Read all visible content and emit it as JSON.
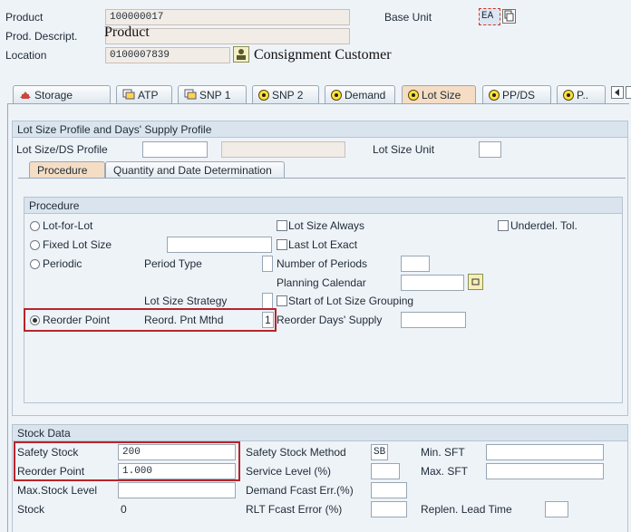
{
  "header": {
    "product_label": "Product",
    "product_value": "100000017",
    "prod_descript_label": "Prod. Descript.",
    "prod_descript_value": "Product",
    "location_label": "Location",
    "location_value": "0100007839",
    "location_name": "Consignment Customer",
    "base_unit_label": "Base Unit",
    "base_unit_value": "EA"
  },
  "tabs": [
    {
      "label": "Storage",
      "icon": "storage-icon"
    },
    {
      "label": "ATP",
      "icon": "atp-icon"
    },
    {
      "label": "SNP 1",
      "icon": "snp-icon"
    },
    {
      "label": "SNP 2",
      "icon": "radio-icon"
    },
    {
      "label": "Demand",
      "icon": "radio-icon"
    },
    {
      "label": "Lot Size",
      "icon": "radio-icon",
      "active": true
    },
    {
      "label": "PP/DS",
      "icon": "radio-icon"
    },
    {
      "label": "P..",
      "icon": "radio-icon"
    }
  ],
  "lot_size_profile": {
    "section_title": "Lot Size Profile and Days' Supply Profile",
    "profile_label": "Lot Size/DS Profile",
    "profile_value": "",
    "profile_desc": "",
    "unit_label": "Lot Size Unit",
    "unit_value": ""
  },
  "subtabs": {
    "procedure": "Procedure",
    "quantity": "Quantity and Date Determination"
  },
  "procedure": {
    "title": "Procedure",
    "lot_for_lot": "Lot-for-Lot",
    "fixed_lot_size": "Fixed Lot Size",
    "periodic": "Periodic",
    "reorder_point": "Reorder Point",
    "period_type": "Period Type",
    "lot_size_strategy": "Lot Size Strategy",
    "reord_pnt_mthd": "Reord. Pnt Mthd",
    "reord_pnt_mthd_value": "1",
    "lot_size_always": "Lot Size Always",
    "last_lot_exact": "Last Lot Exact",
    "number_of_periods": "Number of Periods",
    "planning_calendar": "Planning Calendar",
    "start_of_lot_size_grouping": "Start of Lot Size Grouping",
    "reorder_days_supply": "Reorder Days' Supply",
    "underdel_tol": "Underdel. Tol.",
    "selected": "reorder_point"
  },
  "stock": {
    "title": "Stock Data",
    "safety_stock_label": "Safety Stock",
    "safety_stock_value": "200",
    "reorder_point_label": "Reorder Point",
    "reorder_point_value": "1.000",
    "max_stock_label": "Max.Stock Level",
    "max_stock_value": "",
    "stock_label": "Stock",
    "stock_value": "0",
    "safety_stock_method_label": "Safety Stock Method",
    "safety_stock_method_value": "SB",
    "service_level_label": "Service Level (%)",
    "demand_fcast_label": "Demand Fcast Err.(%)",
    "rlt_fcast_label": "RLT Fcast Error (%)",
    "min_sft_label": "Min. SFT",
    "max_sft_label": "Max. SFT",
    "replen_lead_time_label": "Replen. Lead Time"
  },
  "colors": {
    "highlight_box": "#b8242b",
    "active_tab": "#f5ddc4",
    "background": "#eef3f8"
  }
}
